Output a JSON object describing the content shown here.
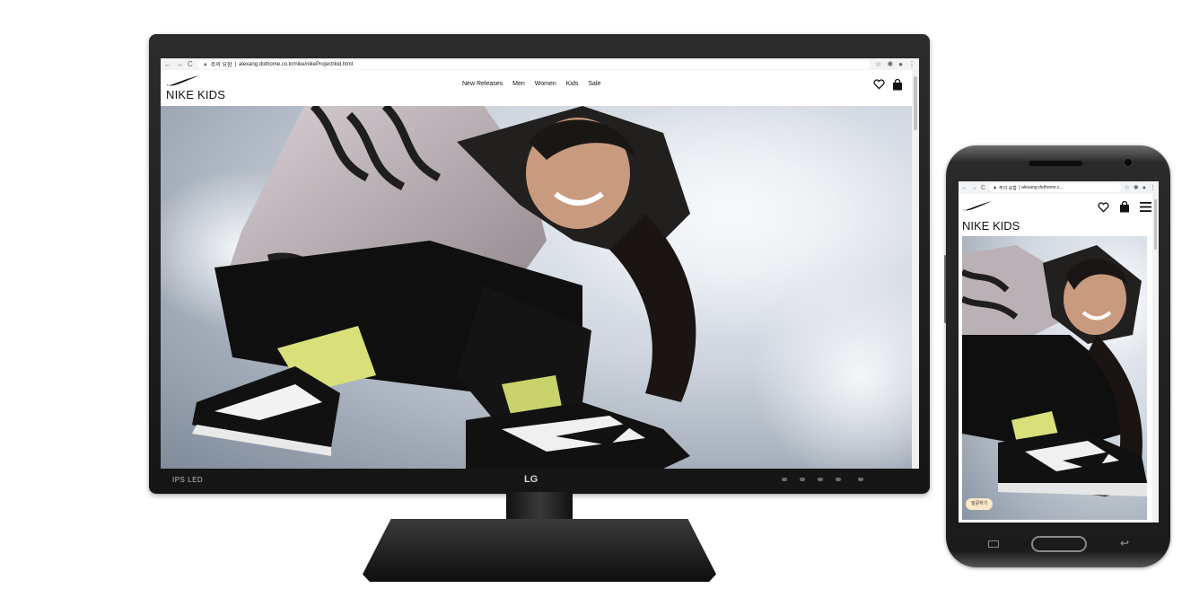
{
  "browser": {
    "security_label": "주의 요함",
    "url": "alexang.dothome.co.kr/nike/nikeProject/kid.html",
    "mobile_url": "alexang.dothome.c..."
  },
  "site": {
    "brand_name": "NIKE KIDS",
    "nav": [
      "New Releases",
      "Men",
      "Women",
      "Kids",
      "Sale"
    ],
    "chat_button": "질문하기"
  },
  "monitor": {
    "brand": "LG",
    "badge": "IPS LED"
  },
  "colors": {
    "chip_bg": "#fde7c7",
    "bezel": "#1b1b1b"
  },
  "icons": [
    "back-icon",
    "forward-icon",
    "reload-icon",
    "warning-icon",
    "star-icon",
    "extensions-icon",
    "profile-icon",
    "more-icon",
    "swoosh-icon",
    "heart-icon",
    "bag-icon",
    "menu-icon"
  ]
}
